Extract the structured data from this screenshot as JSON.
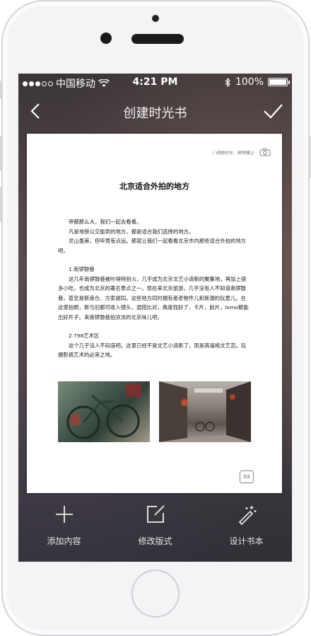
{
  "status_bar": {
    "carrier": "中国移动",
    "time": "4:21 PM",
    "battery": "100%",
    "battery_level": 1.0
  },
  "nav": {
    "title": "创建时光书",
    "back_icon": "chevron-left-icon",
    "confirm_icon": "checkmark-icon"
  },
  "page": {
    "tag": "/ 何妨时光，获然随上 ·",
    "title": "北京适合外拍的地方",
    "paragraphs": [
      "帝都那么大，我们一起去看看。",
      "凡是地铁公交能到的地方，都是适合我们选择的地方。",
      "灵山虽美，但毕竟有点远。那就让我们一起看看北京市内那些适合外拍的地方吧。"
    ],
    "section1_heading": "1.南锣鼓巷",
    "section1_text": "这几年南锣鼓巷被吵得特别火，几乎成为北京文艺小清新的聚集地，再加上很多小吃，也成为北京的著名景点之一。现在来北京旅游，几乎没有人不知道南锣鼓巷，甚至是新南仓、方家胡同。这些地方同时拥有者老物件儿和新潮的玩意儿。在这里拍照，新与旧都可收入镜头，混搭比对，角度找好了，卡片，胶片，lomo都能出好片子。来南锣鼓巷拍浓浓的北京味儿吧。",
    "section2_heading": "2.798艺术区",
    "section2_text": "这个几乎没人不知道吧。这里已经不是文艺小清新了，而是高逼格文艺范。玩摄影搞艺术的必来之地。",
    "page_number": "03"
  },
  "toolbar": {
    "items": [
      {
        "label": "添加内容",
        "icon": "plus-icon"
      },
      {
        "label": "修改版式",
        "icon": "edit-icon"
      },
      {
        "label": "设计书本",
        "icon": "magic-wand-icon"
      }
    ]
  }
}
